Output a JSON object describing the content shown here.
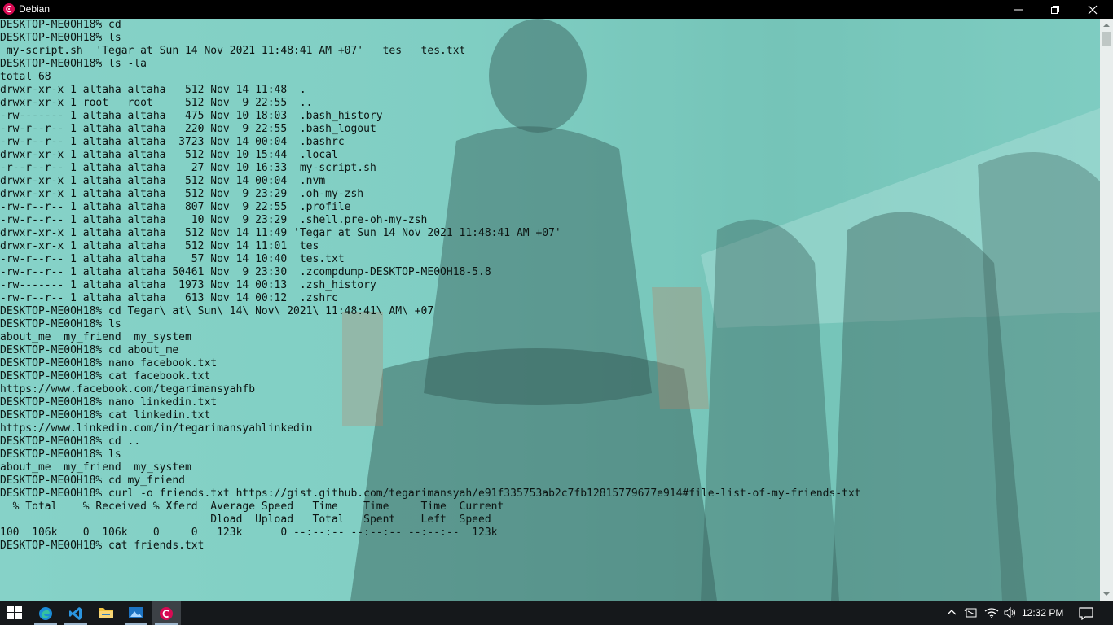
{
  "window": {
    "title": "Debian"
  },
  "terminal": {
    "lines": [
      "DESKTOP-ME0OH18% cd",
      "DESKTOP-ME0OH18% ls",
      " my-script.sh  'Tegar at Sun 14 Nov 2021 11:48:41 AM +07'   tes   tes.txt",
      "DESKTOP-ME0OH18% ls -la",
      "total 68",
      "drwxr-xr-x 1 altaha altaha   512 Nov 14 11:48  .",
      "drwxr-xr-x 1 root   root     512 Nov  9 22:55  ..",
      "-rw------- 1 altaha altaha   475 Nov 10 18:03  .bash_history",
      "-rw-r--r-- 1 altaha altaha   220 Nov  9 22:55  .bash_logout",
      "-rw-r--r-- 1 altaha altaha  3723 Nov 14 00:04  .bashrc",
      "drwxr-xr-x 1 altaha altaha   512 Nov 10 15:44  .local",
      "-r--r--r-- 1 altaha altaha    27 Nov 10 16:33  my-script.sh",
      "drwxr-xr-x 1 altaha altaha   512 Nov 14 00:04  .nvm",
      "drwxr-xr-x 1 altaha altaha   512 Nov  9 23:29  .oh-my-zsh",
      "-rw-r--r-- 1 altaha altaha   807 Nov  9 22:55  .profile",
      "-rw-r--r-- 1 altaha altaha    10 Nov  9 23:29  .shell.pre-oh-my-zsh",
      "drwxr-xr-x 1 altaha altaha   512 Nov 14 11:49 'Tegar at Sun 14 Nov 2021 11:48:41 AM +07'",
      "drwxr-xr-x 1 altaha altaha   512 Nov 14 11:01  tes",
      "-rw-r--r-- 1 altaha altaha    57 Nov 14 10:40  tes.txt",
      "-rw-r--r-- 1 altaha altaha 50461 Nov  9 23:30  .zcompdump-DESKTOP-ME0OH18-5.8",
      "-rw------- 1 altaha altaha  1973 Nov 14 00:13  .zsh_history",
      "-rw-r--r-- 1 altaha altaha   613 Nov 14 00:12  .zshrc",
      "DESKTOP-ME0OH18% cd Tegar\\ at\\ Sun\\ 14\\ Nov\\ 2021\\ 11:48:41\\ AM\\ +07",
      "DESKTOP-ME0OH18% ls",
      "about_me  my_friend  my_system",
      "DESKTOP-ME0OH18% cd about_me",
      "DESKTOP-ME0OH18% nano facebook.txt",
      "DESKTOP-ME0OH18% cat facebook.txt",
      "https://www.facebook.com/tegarimansyahfb",
      "DESKTOP-ME0OH18% nano linkedin.txt",
      "DESKTOP-ME0OH18% cat linkedin.txt",
      "https://www.linkedin.com/in/tegarimansyahlinkedin",
      "DESKTOP-ME0OH18% cd ..",
      "DESKTOP-ME0OH18% ls",
      "about_me  my_friend  my_system",
      "DESKTOP-ME0OH18% cd my_friend",
      "DESKTOP-ME0OH18% curl -o friends.txt https://gist.github.com/tegarimansyah/e91f335753ab2c7fb12815779677e914#file-list-of-my-friends-txt",
      "  % Total    % Received % Xferd  Average Speed   Time    Time     Time  Current",
      "                                 Dload  Upload   Total   Spent    Left  Speed",
      "100  106k    0  106k    0     0   123k      0 --:--:-- --:--:-- --:--:--  123k",
      "DESKTOP-ME0OH18% cat friends.txt"
    ]
  },
  "taskbar": {
    "apps": [
      {
        "name": "start-icon"
      },
      {
        "name": "edge-icon"
      },
      {
        "name": "vscode-icon"
      },
      {
        "name": "file-explorer-icon"
      },
      {
        "name": "photos-icon"
      },
      {
        "name": "debian-icon"
      }
    ],
    "tray_icons": [
      "chevron-up-icon",
      "input-language-icon",
      "wifi-icon",
      "volume-icon"
    ],
    "clock": "12:32 PM",
    "notification_icon": "action-center-icon"
  },
  "colors": {
    "terminal_bg": "#7ecdc2",
    "terminal_text": "#0c1412",
    "titlebar_bg": "#000000",
    "taskbar_bg": "#15181b",
    "debian_red": "#d70a53"
  }
}
